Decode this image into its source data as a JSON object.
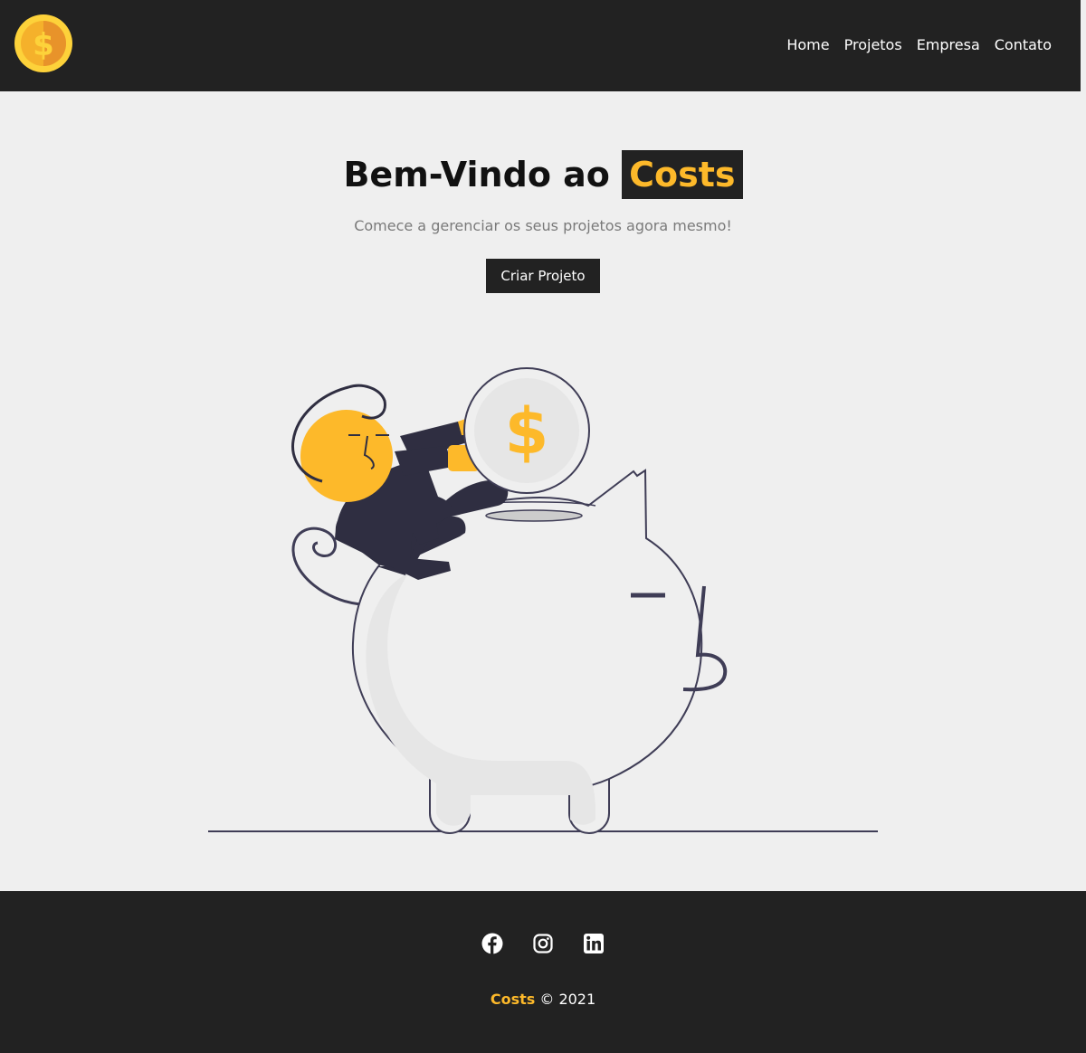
{
  "nav": {
    "logo_icon": "coin-dollar-icon",
    "links": [
      "Home",
      "Projetos",
      "Empresa",
      "Contato"
    ]
  },
  "hero": {
    "title_prefix": "Bem-Vindo ao",
    "title_brand": "Costs",
    "subtitle": "Comece a gerenciar os seus projetos agora mesmo!",
    "cta_label": "Criar Projeto",
    "illustration": "piggy-bank-savings-illustration"
  },
  "footer": {
    "social_icons": [
      "facebook-icon",
      "instagram-icon",
      "linkedin-icon"
    ],
    "brand": "Costs",
    "copyright_suffix": "© 2021"
  },
  "colors": {
    "dark": "#222222",
    "accent": "#fdb92a",
    "background": "#efefef",
    "muted_text": "#7a7a7a"
  }
}
